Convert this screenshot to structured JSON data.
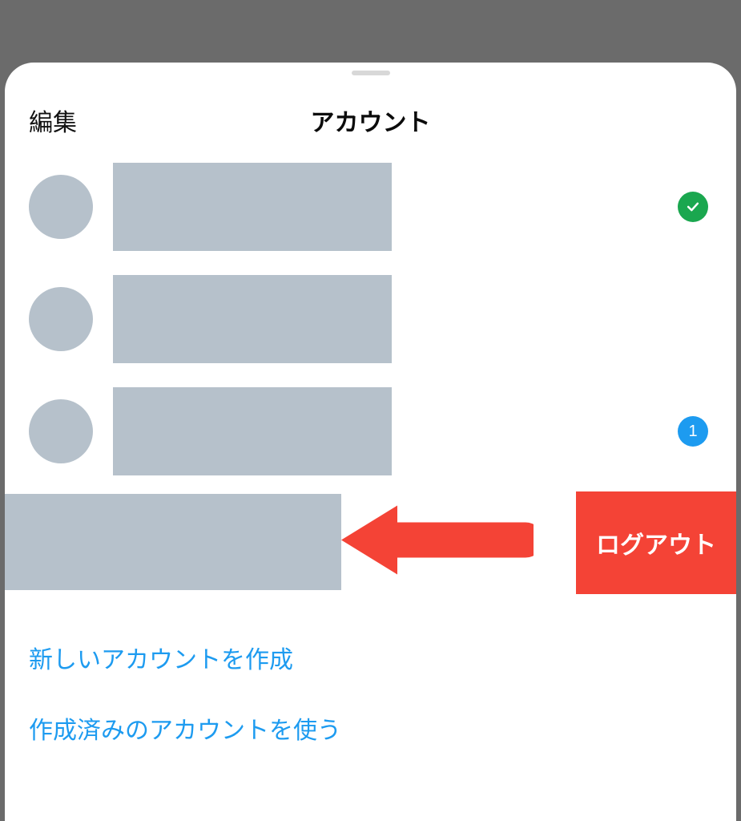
{
  "header": {
    "edit_label": "編集",
    "title": "アカウント"
  },
  "accounts": [
    {
      "status": "check"
    },
    {
      "status": "none"
    },
    {
      "status": "badge",
      "badge_count": "1"
    }
  ],
  "swipe": {
    "logout_label": "ログアウト"
  },
  "links": {
    "create_account": "新しいアカウントを作成",
    "use_existing": "作成済みのアカウントを使う"
  }
}
